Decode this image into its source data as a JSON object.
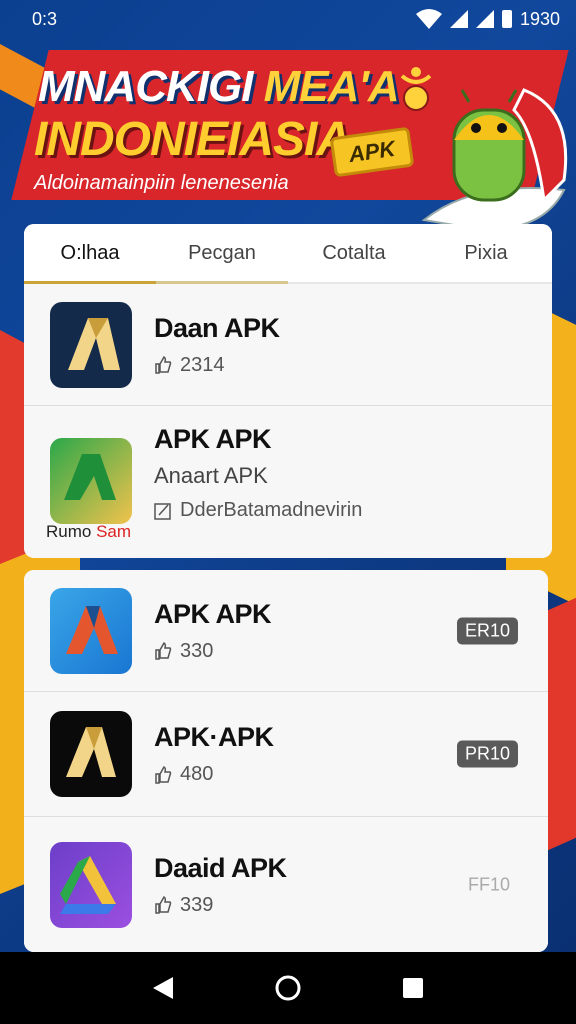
{
  "status_bar": {
    "time": "0:3",
    "clock_right": "1930"
  },
  "banner": {
    "title_line1_a": "MNACKIGI ",
    "title_line1_b": "MEA'A",
    "title_line2": "INDONIEIASIA",
    "subtitle": "Aldoinamainpiin lenenesenia",
    "apk_badge": "APK"
  },
  "tabs": [
    {
      "label": "O:lhaa",
      "active": true
    },
    {
      "label": "Pecgan",
      "active": false
    },
    {
      "label": "Cotalta",
      "active": false
    },
    {
      "label": "Pixia",
      "active": false
    }
  ],
  "top_list": [
    {
      "name": "Daan APK",
      "likes": "2314"
    },
    {
      "name": "APK APK",
      "subtitle": "Anaart APK",
      "developer": "DderBatamadnevirin",
      "icon_caption_a": "Rumo",
      "icon_caption_b": "Sam"
    }
  ],
  "bottom_list": [
    {
      "name": "APK APK",
      "likes": "330",
      "badge": "ER10"
    },
    {
      "name": "APK·APK",
      "likes": "480",
      "badge": "PR10"
    },
    {
      "name": "Daaid APK",
      "likes": "339",
      "badge": "FF10"
    }
  ],
  "colors": {
    "background": "#0d3a84",
    "banner_red": "#d8262b",
    "accent_yellow": "#f6c423",
    "tab_indicator": "#c8a43a",
    "badge": "#5a5a5a"
  },
  "icons": {
    "like": "thumbs-up-icon",
    "developer": "edit-square-icon",
    "nav_back": "triangle-back-icon",
    "nav_home": "circle-home-icon",
    "nav_recents": "square-recents-icon"
  }
}
